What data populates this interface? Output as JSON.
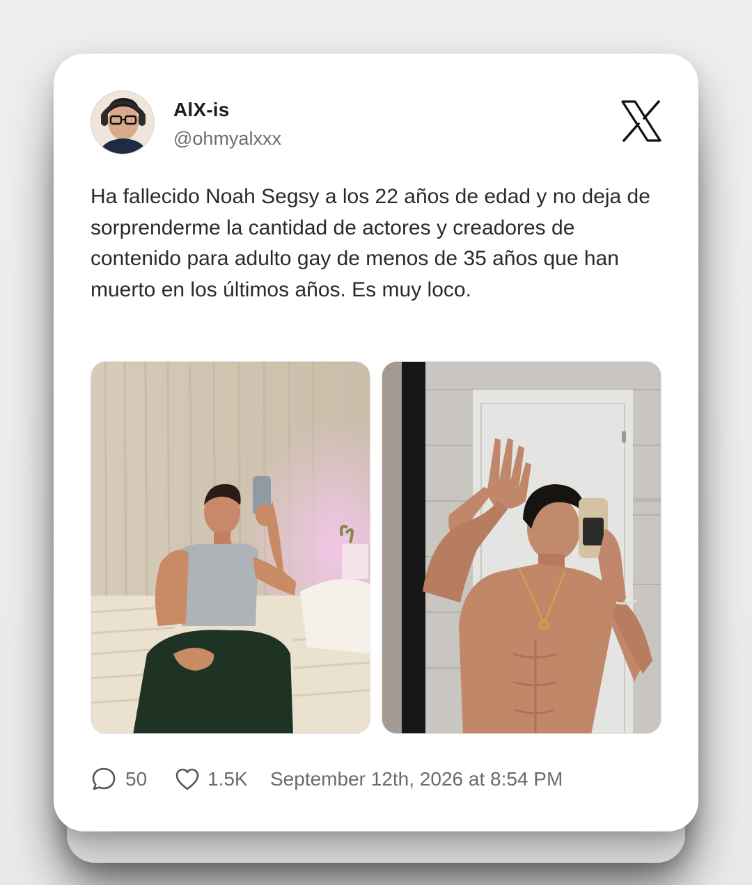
{
  "author": {
    "name": "AlX-is",
    "handle": "@ohmyalxxx",
    "avatar": "avatar"
  },
  "brand_icon": "x-logo-icon",
  "tweet": {
    "text": "Ha fallecido Noah Segsy a los 22 años de edad y no deja de sorprenderme la cantidad de actores y creadores de contenido para adulto gay de menos de 35 años que han muerto en los últimos años. Es muy loco."
  },
  "media": [
    {
      "name": "photo-left",
      "kind": "photo"
    },
    {
      "name": "photo-right",
      "kind": "photo"
    }
  ],
  "footer": {
    "comments": {
      "icon": "comment-icon",
      "count": "50"
    },
    "likes": {
      "icon": "heart-icon",
      "count": "1.5K"
    },
    "timestamp": "September 12th, 2026 at 8:54 PM"
  },
  "colors": {
    "card_background": "#ffffff",
    "page_background": "#ededed",
    "name_text": "#1c1c1c",
    "muted_text": "#6d6d6d"
  }
}
